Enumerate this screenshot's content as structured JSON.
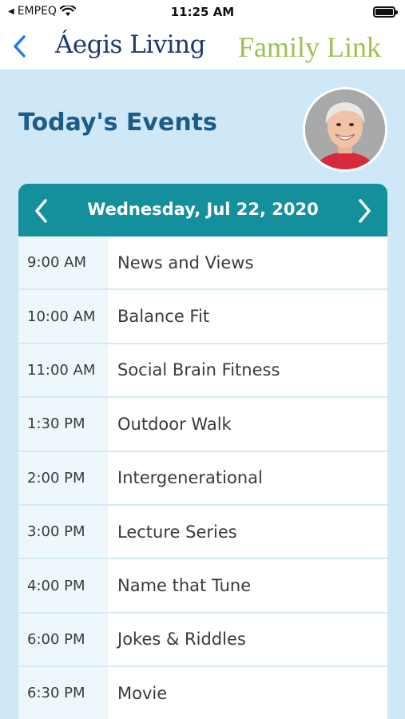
{
  "status_bar": {
    "carrier": "EMPEQ",
    "time": "11:25 AM"
  },
  "nav": {
    "brand_primary": "Áegis Living",
    "brand_secondary": "Family Link"
  },
  "page": {
    "title": "Today's Events"
  },
  "calendar": {
    "date": "Wednesday, Jul 22, 2020",
    "events": [
      {
        "time": "9:00 AM",
        "name": "News and Views"
      },
      {
        "time": "10:00 AM",
        "name": "Balance Fit"
      },
      {
        "time": "11:00 AM",
        "name": "Social Brain Fitness"
      },
      {
        "time": "1:30 PM",
        "name": "Outdoor Walk"
      },
      {
        "time": "2:00 PM",
        "name": "Intergenerational"
      },
      {
        "time": "3:00 PM",
        "name": "Lecture Series"
      },
      {
        "time": "4:00 PM",
        "name": "Name that Tune"
      },
      {
        "time": "6:00 PM",
        "name": "Jokes & Riddles"
      },
      {
        "time": "6:30 PM",
        "name": "Movie"
      }
    ]
  },
  "colors": {
    "background": "#cfe8f7",
    "header_teal": "#14909c",
    "title_blue": "#1b5c8a",
    "brand_navy": "#1e3a6e",
    "brand_green": "#9dc24f",
    "ios_blue": "#1a7cf0"
  },
  "icons": {
    "back": "chevron-left-icon",
    "prev": "chevron-left-icon",
    "next": "chevron-right-icon",
    "wifi": "wifi-icon",
    "battery": "battery-icon"
  }
}
